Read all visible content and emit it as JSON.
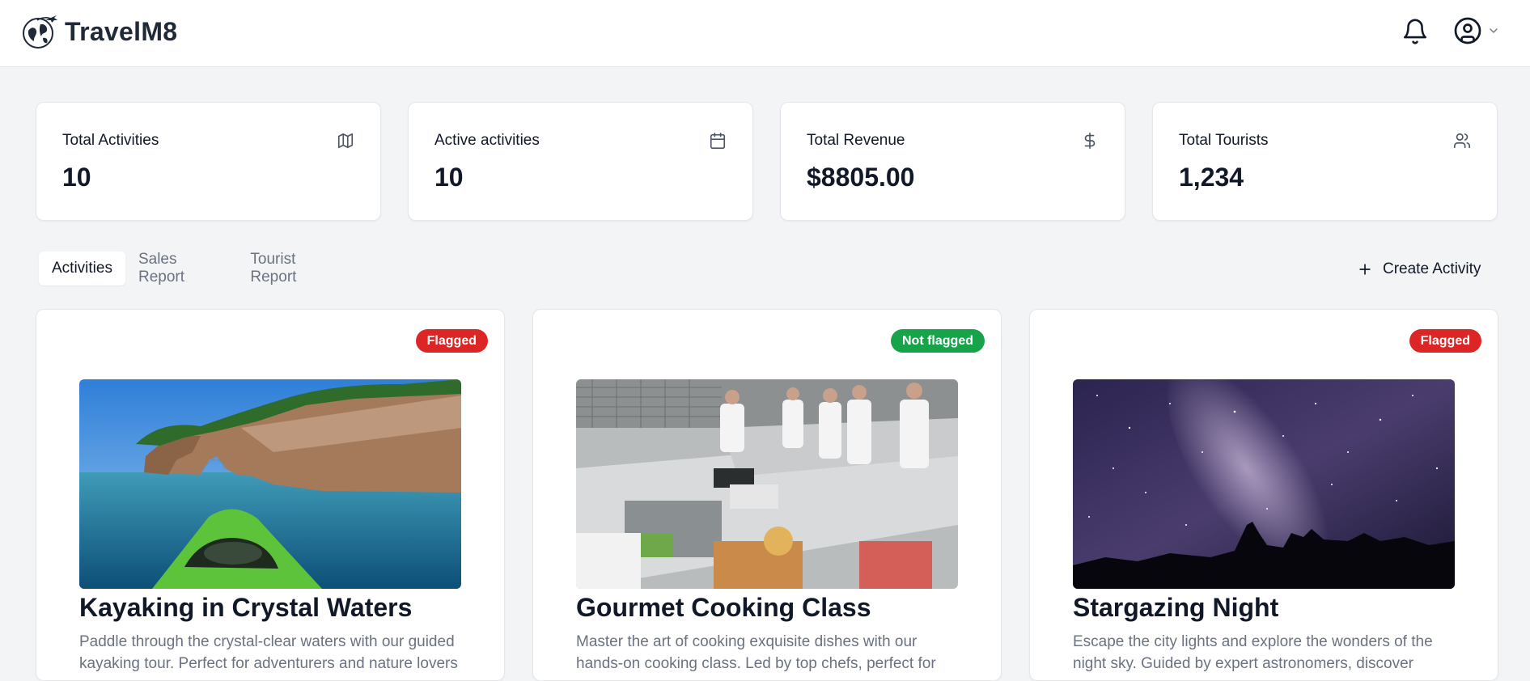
{
  "header": {
    "brand": "TravelM8",
    "icons": {
      "logo": "globe-plane-logo",
      "notifications": "bell-icon",
      "account": "user-circle-icon",
      "menu": "chevron-down-icon"
    }
  },
  "stats": [
    {
      "label": "Total Activities",
      "value": "10",
      "icon": "map-icon"
    },
    {
      "label": "Active activities",
      "value": "10",
      "icon": "calendar-icon"
    },
    {
      "label": "Total Revenue",
      "value": "$8805.00",
      "icon": "dollar-icon"
    },
    {
      "label": "Total Tourists",
      "value": "1,234",
      "icon": "users-icon"
    }
  ],
  "tabs": [
    {
      "label": "Activities",
      "active": true
    },
    {
      "label": "Sales Report",
      "active": false
    },
    {
      "label": "Tourist Report",
      "active": false
    }
  ],
  "actions": {
    "create_label": "Create Activity",
    "create_icon": "plus-icon"
  },
  "activities": [
    {
      "title": "Kayaking in Crystal Waters",
      "status": "Flagged",
      "description": "Paddle through the crystal-clear waters with our guided kayaking tour. Perfect for adventurers and nature lovers",
      "image": "kayak-sea-arch-photo"
    },
    {
      "title": "Gourmet Cooking Class",
      "status": "Not flagged",
      "description": "Master the art of cooking exquisite dishes with our hands-on cooking class. Led by top chefs, perfect for",
      "image": "cooking-class-kitchen-photo"
    },
    {
      "title": "Stargazing Night",
      "status": "Flagged",
      "description": "Escape the city lights and explore the wonders of the night sky. Guided by expert astronomers, discover",
      "image": "milky-way-night-sky-photo"
    }
  ],
  "colors": {
    "flagged": "#dc2626",
    "not_flagged": "#16a34a",
    "background": "#f3f4f6"
  }
}
